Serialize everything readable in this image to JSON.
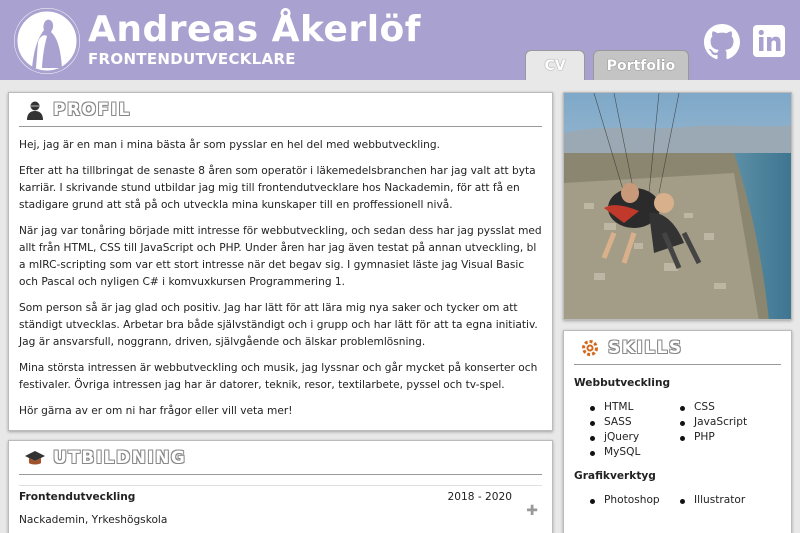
{
  "header": {
    "name": "Andreas Åkerlöf",
    "title": "FRONTENDUTVECKLARE",
    "icons": [
      "github-icon",
      "linkedin-icon"
    ]
  },
  "tabs": [
    {
      "label": "CV",
      "active": true
    },
    {
      "label": "Portfolio",
      "active": false
    }
  ],
  "profile": {
    "heading": "PROFIL",
    "paragraphs": [
      "Hej, jag är en man i mina bästa år som pysslar en hel del med webbutveckling.",
      "Efter att ha tillbringat de senaste 8 åren som operatör i läkemedelsbranchen har jag valt att byta karriär. I skrivande stund utbildar jag mig till frontendutvecklare hos Nackademin, för att få en stadigare grund att stå på och utveckla mina kunskaper till en proffessionell nivå.",
      "När jag var tonåring började mitt intresse för webbutveckling, och sedan dess har jag pysslat med allt från HTML, CSS till JavaScript och PHP. Under åren har jag även testat på annan utveckling, bl a mIRC-scripting som var ett stort intresse när det begav sig. I gymnasiet läste jag Visual Basic och Pascal och nyligen C# i komvuxkursen Programmering 1.",
      "Som person så är jag glad och positiv. Jag har lätt för att lära mig nya saker och tycker om att ständigt utvecklas. Arbetar bra både självständigt och i grupp och har lätt för att ta egna initiativ. Jag är ansvarsfull, noggrann, driven, självgående och älskar problemlösning.",
      "Mina största intressen är webbutveckling och musik, jag lyssnar och går mycket på konserter och festivaler. Övriga intressen jag har är datorer, teknik, resor, textilarbete, pyssel och tv-spel.",
      "Hör gärna av er om ni har frågor eller vill veta mer!"
    ]
  },
  "education": {
    "heading": "UTBILDNING",
    "items": [
      {
        "title": "Frontendutveckling",
        "years": "2018 - 2020",
        "school": "Nackademin, Yrkeshögskola"
      }
    ]
  },
  "skills": {
    "heading": "SKILLS",
    "categories": [
      {
        "name": "Webbutveckling",
        "items": [
          "HTML",
          "CSS",
          "SASS",
          "JavaScript",
          "jQuery",
          "PHP",
          "MySQL"
        ]
      },
      {
        "name": "Grafikverktyg",
        "items": [
          "Photoshop",
          "Illustrator"
        ]
      }
    ]
  }
}
